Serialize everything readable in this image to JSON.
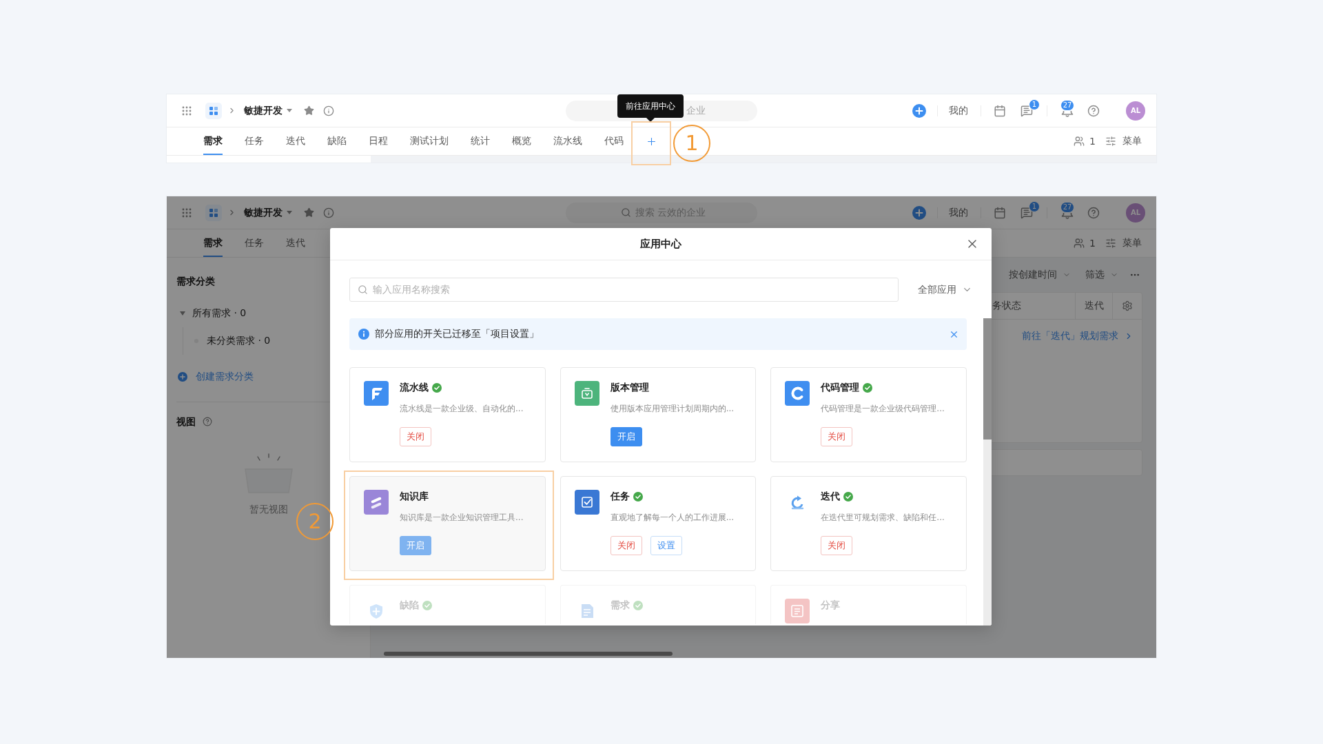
{
  "top_view": {
    "project": "敏捷开发",
    "search": {
      "placeholder": "企业"
    },
    "tooltip": "前往应用中心",
    "my_link": "我的",
    "message_badge": "1",
    "notification_badge": "27",
    "avatar": "AL",
    "tabs": [
      {
        "label": "需求",
        "selected": true
      },
      {
        "label": "任务",
        "selected": false
      },
      {
        "label": "迭代",
        "selected": false
      },
      {
        "label": "缺陷",
        "selected": false
      },
      {
        "label": "日程",
        "selected": false
      },
      {
        "label": "测试计划",
        "selected": false
      },
      {
        "label": "统计",
        "selected": false
      },
      {
        "label": "概览",
        "selected": false
      },
      {
        "label": "流水线",
        "selected": false
      },
      {
        "label": "代码",
        "selected": false
      }
    ],
    "member_count": "1",
    "menu": "菜单",
    "step_marker": "1"
  },
  "bottom_view": {
    "project": "敏捷开发",
    "search": {
      "placeholder": "搜索 云效的企业"
    },
    "my_link": "我的",
    "message_badge": "1",
    "notification_badge": "27",
    "avatar": "AL",
    "tabs": [
      {
        "label": "需求",
        "selected": true
      },
      {
        "label": "任务",
        "selected": false
      },
      {
        "label": "迭代",
        "selected": false
      }
    ],
    "member_count": "1",
    "menu": "菜单",
    "sidebar": {
      "title": "需求分类",
      "tree": [
        {
          "label": "所有需求 · 0",
          "expanded": true,
          "children": [
            {
              "label": "未分类需求 · 0"
            }
          ]
        }
      ],
      "create_link": "创建需求分类",
      "views_title": "视图",
      "views_empty": "暂无视图"
    },
    "toolbar": {
      "sort": "按创建时间",
      "filter": "筛选"
    },
    "table": {
      "columns": [
        "务状态",
        "迭代"
      ],
      "link": "前往「迭代」规划需求"
    },
    "modal": {
      "title": "应用中心",
      "search": {
        "placeholder": "输入应用名称搜索"
      },
      "scope": "全部应用",
      "notice": "部分应用的开关已迁移至「项目设置」",
      "apps": [
        {
          "name": "流水线",
          "enabled": true,
          "highlighted": false,
          "description": "流水线是一款企业级、自动化的...",
          "buttons": [
            {
              "label": "关闭",
              "kind": "danger"
            }
          ]
        },
        {
          "name": "版本管理",
          "enabled": false,
          "highlighted": false,
          "description": "使用版本应用管理计划周期内的...",
          "buttons": [
            {
              "label": "开启",
              "kind": "primary"
            }
          ]
        },
        {
          "name": "代码管理",
          "enabled": true,
          "highlighted": false,
          "description": "代码管理是一款企业级代码管理...",
          "buttons": [
            {
              "label": "关闭",
              "kind": "danger"
            }
          ]
        },
        {
          "name": "知识库",
          "enabled": false,
          "highlighted": true,
          "description": "知识库是一款企业知识管理工具...",
          "buttons": [
            {
              "label": "开启",
              "kind": "primary"
            }
          ]
        },
        {
          "name": "任务",
          "enabled": true,
          "highlighted": false,
          "description": "直观地了解每一个人的工作进展...",
          "buttons": [
            {
              "label": "关闭",
              "kind": "danger"
            },
            {
              "label": "设置",
              "kind": "default"
            }
          ]
        },
        {
          "name": "迭代",
          "enabled": true,
          "highlighted": false,
          "description": "在迭代里可规划需求、缺陷和任...",
          "buttons": [
            {
              "label": "关闭",
              "kind": "danger"
            }
          ]
        },
        {
          "name": "缺陷",
          "enabled": true,
          "highlighted": false
        },
        {
          "name": "需求",
          "enabled": true,
          "highlighted": false
        },
        {
          "name": "分享",
          "enabled": false,
          "highlighted": false
        }
      ]
    },
    "step_marker": "2"
  }
}
